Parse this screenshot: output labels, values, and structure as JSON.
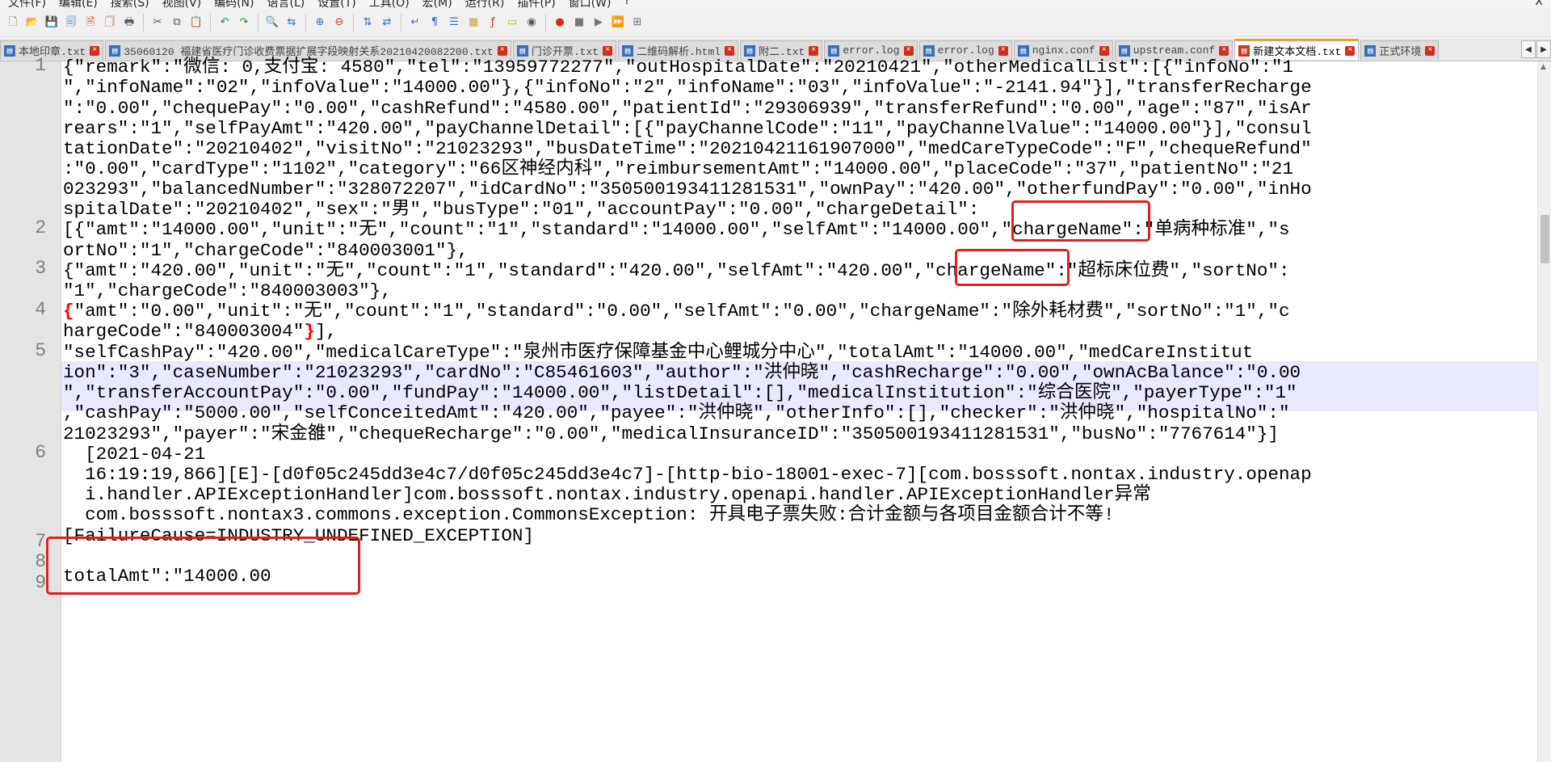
{
  "menu": [
    "文件(F)",
    "编辑(E)",
    "搜索(S)",
    "视图(V)",
    "编码(N)",
    "语言(L)",
    "设置(T)",
    "工具(O)",
    "宏(M)",
    "运行(R)",
    "插件(P)",
    "窗口(W)",
    "?"
  ],
  "window": {
    "close_label": "X"
  },
  "toolbar": [
    {
      "name": "new-file-icon",
      "glyph": "🗋",
      "color": "#3a8a3a"
    },
    {
      "name": "open-file-icon",
      "glyph": "📂",
      "color": "#c9a227"
    },
    {
      "name": "save-icon",
      "glyph": "💾",
      "color": "#3a6fb8"
    },
    {
      "name": "save-all-icon",
      "glyph": "🗐",
      "color": "#3a6fb8"
    },
    {
      "name": "close-file-icon",
      "glyph": "🗎",
      "color": "#c0392b"
    },
    {
      "name": "close-all-icon",
      "glyph": "🗍",
      "color": "#c0392b"
    },
    {
      "name": "print-icon",
      "glyph": "🖶",
      "color": "#555555"
    },
    {
      "sep": true
    },
    {
      "name": "cut-icon",
      "glyph": "✂",
      "color": "#555555"
    },
    {
      "name": "copy-icon",
      "glyph": "⧉",
      "color": "#555555"
    },
    {
      "name": "paste-icon",
      "glyph": "📋",
      "color": "#b07b2a"
    },
    {
      "sep": true
    },
    {
      "name": "undo-icon",
      "glyph": "↶",
      "color": "#2a8a2a"
    },
    {
      "name": "redo-icon",
      "glyph": "↷",
      "color": "#2a8a2a"
    },
    {
      "sep": true
    },
    {
      "name": "find-icon",
      "glyph": "🔍",
      "color": "#555555"
    },
    {
      "name": "replace-icon",
      "glyph": "⇆",
      "color": "#3a6fb8"
    },
    {
      "sep": true
    },
    {
      "name": "zoom-in-icon",
      "glyph": "⊕",
      "color": "#3a6fb8"
    },
    {
      "name": "zoom-out-icon",
      "glyph": "⊖",
      "color": "#c0392b"
    },
    {
      "sep": true
    },
    {
      "name": "sync-vertical-icon",
      "glyph": "⇅",
      "color": "#3a6fb8"
    },
    {
      "name": "sync-horizontal-icon",
      "glyph": "⇄",
      "color": "#3a6fb8"
    },
    {
      "sep": true
    },
    {
      "name": "word-wrap-icon",
      "glyph": "↵",
      "color": "#3a6fb8"
    },
    {
      "name": "show-symbols-icon",
      "glyph": "¶",
      "color": "#3a6fb8"
    },
    {
      "name": "indent-guide-icon",
      "glyph": "☰",
      "color": "#3a6fb8"
    },
    {
      "name": "language-icon",
      "glyph": "▦",
      "color": "#c9a227"
    },
    {
      "name": "function-list-icon",
      "glyph": "ƒ",
      "color": "#c0392b"
    },
    {
      "name": "folder-workspace-icon",
      "glyph": "▭",
      "color": "#c9a227"
    },
    {
      "name": "monitoring-icon",
      "glyph": "◉",
      "color": "#555555"
    },
    {
      "sep": true
    },
    {
      "name": "record-macro-icon",
      "glyph": "●",
      "color": "#d0301c"
    },
    {
      "name": "stop-record-icon",
      "glyph": "■",
      "color": "#777777"
    },
    {
      "name": "play-macro-icon",
      "glyph": "▶",
      "color": "#777777"
    },
    {
      "name": "run-macro-multiple-icon",
      "glyph": "⏩",
      "color": "#3a6fb8"
    },
    {
      "name": "save-macro-icon",
      "glyph": "⊞",
      "color": "#777777"
    }
  ],
  "tabs": [
    {
      "label": "本地印章.txt",
      "active": false
    },
    {
      "label": "35060120 福建省医疗门诊收费票据扩展字段映射关系20210420082200.txt",
      "active": false
    },
    {
      "label": "门诊开票.txt",
      "active": false
    },
    {
      "label": "二维码解析.html",
      "active": false
    },
    {
      "label": "附二.txt",
      "active": false
    },
    {
      "label": "error.log",
      "active": false
    },
    {
      "label": "error.log",
      "active": false
    },
    {
      "label": "nginx.conf",
      "active": false
    },
    {
      "label": "upstream.conf",
      "active": false
    },
    {
      "label": "新建文本文档.txt",
      "active": true
    },
    {
      "label": "正式环境",
      "active": false
    }
  ],
  "tab_scroll": {
    "left": "◀",
    "right": "▶"
  },
  "line_numbers": [
    "1",
    "2",
    "3",
    "4",
    "5",
    "6",
    "7",
    "8",
    "9"
  ],
  "code_rows": [
    {
      "text": "{\"remark\":\"微信: 0,支付宝: 4580\",\"tel\":\"13959772277\",\"outHospitalDate\":\"20210421\",\"otherMedicalList\":[{\"infoNo\":\"1"
    },
    {
      "text": "\",\"infoName\":\"02\",\"infoValue\":\"14000.00\"},{\"infoNo\":\"2\",\"infoName\":\"03\",\"infoValue\":\"-2141.94\"}],\"transferRecharge"
    },
    {
      "text": "\":\"0.00\",\"chequePay\":\"0.00\",\"cashRefund\":\"4580.00\",\"patientId\":\"29306939\",\"transferRefund\":\"0.00\",\"age\":\"87\",\"isAr"
    },
    {
      "text": "rears\":\"1\",\"selfPayAmt\":\"420.00\",\"payChannelDetail\":[{\"payChannelCode\":\"11\",\"payChannelValue\":\"14000.00\"}],\"consul"
    },
    {
      "text": "tationDate\":\"20210402\",\"visitNo\":\"21023293\",\"busDateTime\":\"20210421161907000\",\"medCareTypeCode\":\"F\",\"chequeRefund\""
    },
    {
      "text": ":\"0.00\",\"cardType\":\"1102\",\"category\":\"66区神经内科\",\"reimbursementAmt\":\"14000.00\",\"placeCode\":\"37\",\"patientNo\":\"21"
    },
    {
      "text": "023293\",\"balancedNumber\":\"328072207\",\"idCardNo\":\"350500193411281531\",\"ownPay\":\"420.00\",\"otherfundPay\":\"0.00\",\"inHo"
    },
    {
      "text": "spitalDate\":\"20210402\",\"sex\":\"男\",\"busType\":\"01\",\"accountPay\":\"0.00\",\"chargeDetail\":"
    },
    {
      "text": "[{\"amt\":\"14000.00\",\"unit\":\"无\",\"count\":\"1\",\"standard\":\"14000.00\",\"selfAmt\":\"14000.00\",\"chargeName\":\"单病种标准\",\"s"
    },
    {
      "text": "ortNo\":\"1\",\"chargeCode\":\"840003001\"},"
    },
    {
      "text": "{\"amt\":\"420.00\",\"unit\":\"无\",\"count\":\"1\",\"standard\":\"420.00\",\"selfAmt\":\"420.00\",\"chargeName\":\"超标床位费\",\"sortNo\":"
    },
    {
      "text": "\"1\",\"chargeCode\":\"840003003\"},"
    },
    {
      "brace": "{",
      "text": "\"amt\":\"0.00\",\"unit\":\"无\",\"count\":\"1\",\"standard\":\"0.00\",\"selfAmt\":\"0.00\",\"chargeName\":\"除外耗材费\",\"sortNo\":\"1\",\"c"
    },
    {
      "text": "hargeCode\":\"840003004\"",
      "brace_after": "}",
      "after": "],"
    },
    {
      "text": "\"selfCashPay\":\"420.00\",\"medicalCareType\":\"泉州市医疗保障基金中心鲤城分中心\",\"totalAmt\":\"14000.00\",\"medCareInstitut"
    },
    {
      "text": "ion\":\"3\",\"caseNumber\":\"21023293\",\"cardNo\":\"C85461603\",\"author\":\"洪仲晓\",\"cashRecharge\":\"0.00\",\"ownAcBalance\":\"0.00"
    },
    {
      "text": "\",\"transferAccountPay\":\"0.00\",\"fundPay\":\"14000.00\",\"listDetail\":[],\"medicalInstitution\":\"综合医院\",\"payerType\":\"1\""
    },
    {
      "text": ",\"cashPay\":\"5000.00\",\"selfConceitedAmt\":\"420.00\",\"payee\":\"洪仲晓\",\"otherInfo\":[],\"checker\":\"洪仲晓\",\"hospitalNo\":\""
    },
    {
      "text": "21023293\",\"payer\":\"宋金雒\",\"chequeRecharge\":\"0.00\",\"medicalInsuranceID\":\"350500193411281531\",\"busNo\":\"7767614\"}]"
    },
    {
      "text": "  [2021-04-21"
    },
    {
      "text": "  16:19:19,866][E]-[d0f05c245dd3e4c7/d0f05c245dd3e4c7]-[http-bio-18001-exec-7][com.bosssoft.nontax.industry.openap"
    },
    {
      "text": "  i.handler.APIExceptionHandler]com.bosssoft.nontax.industry.openapi.handler.APIExceptionHandler异常"
    },
    {
      "text": "  com.bosssoft.nontax3.commons.exception.CommonsException: 开具电子票失败:合计金额与各项目金额合计不等!"
    },
    {
      "text": "[FailureCause=INDUSTRY_UNDEFINED_EXCEPTION]"
    },
    {
      "text": ""
    },
    {
      "text": "totalAmt\":\"14000.00"
    }
  ],
  "colors": {
    "highlight_box": "#e02020",
    "current_line": "#e8e8ff",
    "brace": "#ff0000",
    "active_tab_accent": "#f0a030"
  }
}
